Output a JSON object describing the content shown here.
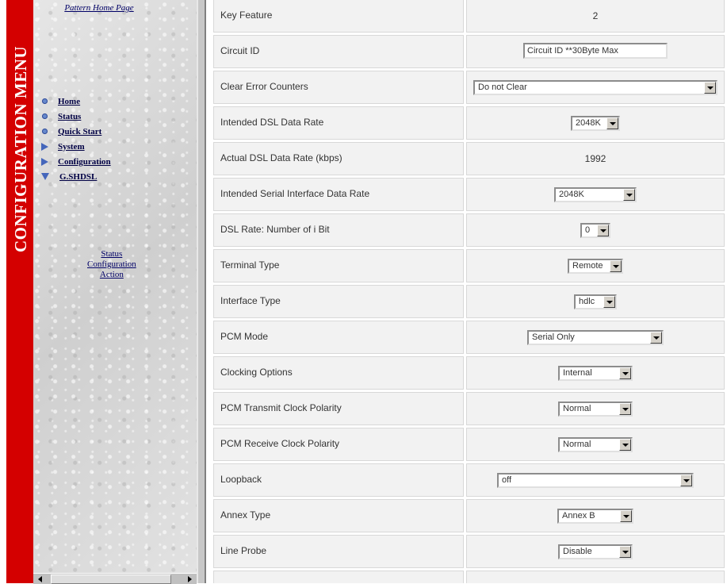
{
  "sidebar": {
    "title": "CONFIGURATION MENU",
    "home_page_link": "Pattern Home Page",
    "items": [
      {
        "label": "Home",
        "icon": "circle-bullet-icon"
      },
      {
        "label": "Status",
        "icon": "circle-bullet-icon"
      },
      {
        "label": "Quick Start",
        "icon": "circle-bullet-icon"
      },
      {
        "label": "System",
        "icon": "triangle-right-icon"
      },
      {
        "label": "Configuration",
        "icon": "triangle-right-icon"
      },
      {
        "label": "G.SHDSL",
        "icon": "triangle-down-icon"
      }
    ],
    "subitems": [
      "Status",
      "Configuration",
      "Action"
    ]
  },
  "config": {
    "key_feature": {
      "label": "Key Feature",
      "value": "2"
    },
    "circuit_id": {
      "label": "Circuit ID",
      "value": "Circuit ID **30Byte Max"
    },
    "clear_error_counters": {
      "label": "Clear Error Counters",
      "value": "Do not Clear"
    },
    "intended_dsl_rate": {
      "label": "Intended DSL Data Rate",
      "value": "2048K"
    },
    "actual_dsl_rate": {
      "label": "Actual DSL Data Rate (kbps)",
      "value": "1992"
    },
    "intended_serial_rate": {
      "label": "Intended Serial Interface Data Rate",
      "value": "2048K"
    },
    "dsl_rate_i_bit": {
      "label": "DSL Rate: Number of i Bit",
      "value": "0"
    },
    "terminal_type": {
      "label": "Terminal Type",
      "value": "Remote"
    },
    "interface_type": {
      "label": "Interface Type",
      "value": "hdlc"
    },
    "pcm_mode": {
      "label": "PCM Mode",
      "value": "Serial Only"
    },
    "clocking_options": {
      "label": "Clocking Options",
      "value": "Internal"
    },
    "pcm_tx_clock_polarity": {
      "label": "PCM Transmit Clock Polarity",
      "value": "Normal"
    },
    "pcm_rx_clock_polarity": {
      "label": "PCM Receive Clock Polarity",
      "value": "Normal"
    },
    "loopback": {
      "label": "Loopback",
      "value": "off"
    },
    "annex_type": {
      "label": "Annex Type",
      "value": "Annex B"
    },
    "line_probe": {
      "label": "Line Probe",
      "value": "Disable"
    }
  },
  "colors": {
    "menu_bar": "#d40000",
    "cell_bg": "#f2f2f2"
  }
}
